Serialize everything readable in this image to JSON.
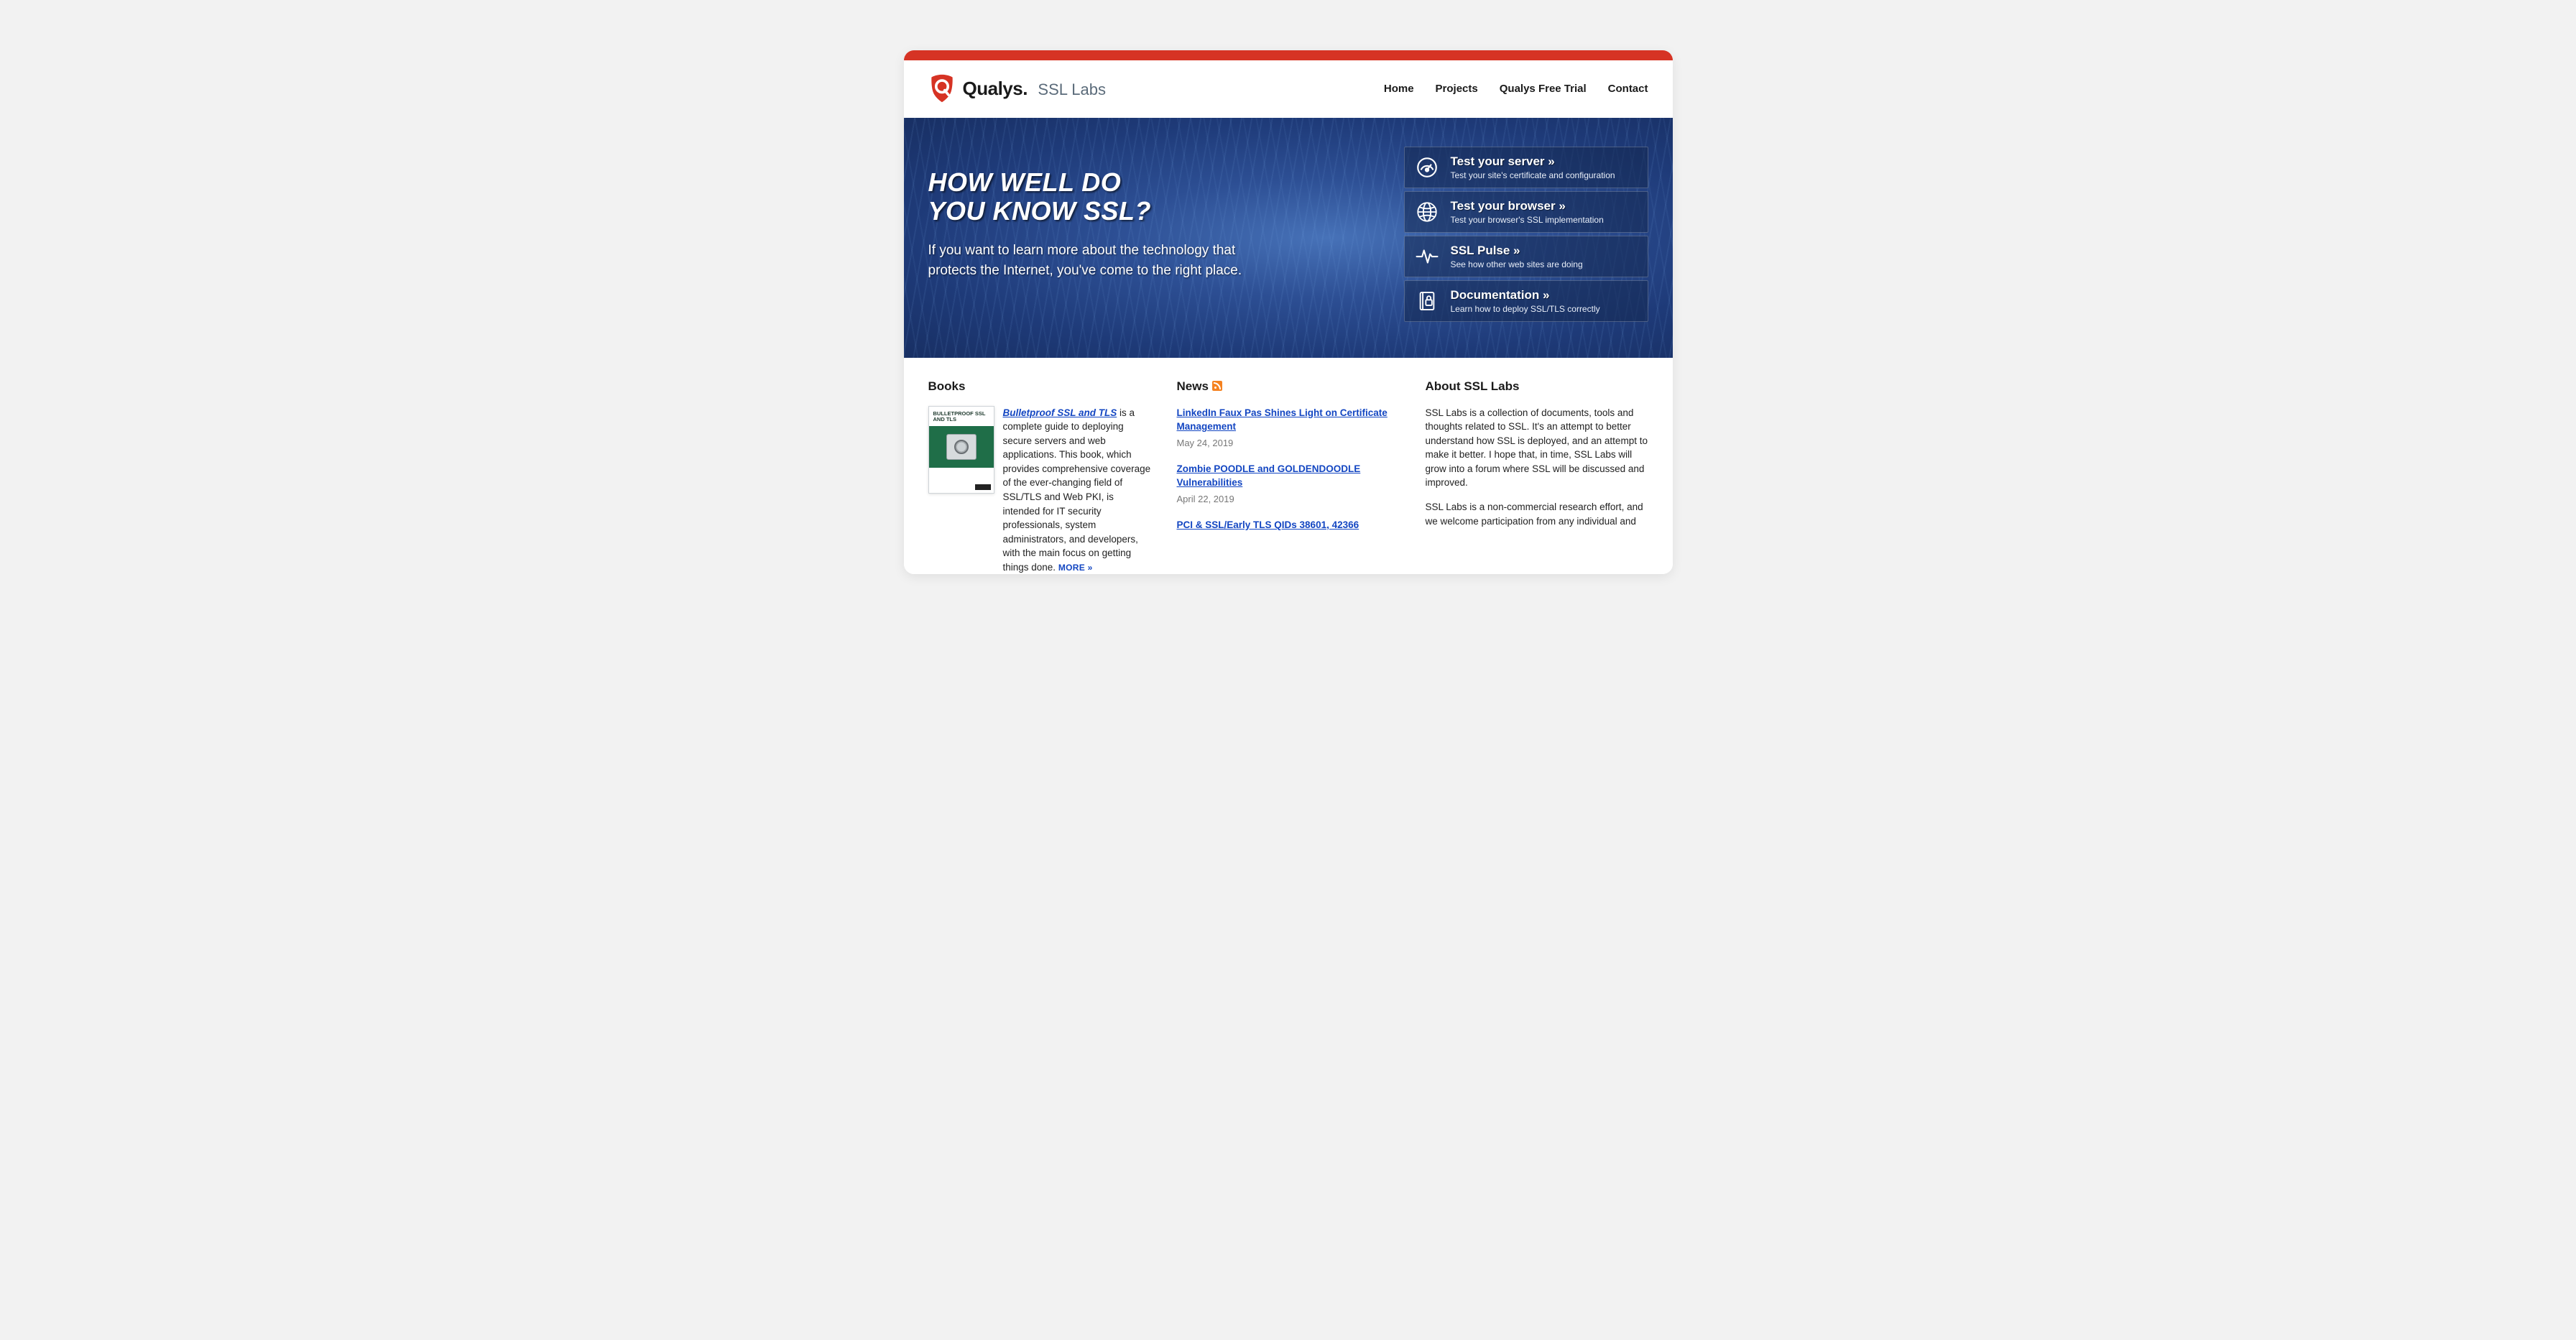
{
  "brand": {
    "name": "Qualys",
    "sub": "SSL Labs"
  },
  "nav": {
    "home": "Home",
    "projects": "Projects",
    "trial": "Qualys Free Trial",
    "contact": "Contact"
  },
  "hero": {
    "title_l1": "HOW WELL DO",
    "title_l2": "YOU KNOW SSL?",
    "desc": "If you want to learn more about the technology that protects the Internet, you've come to the right place."
  },
  "panels": {
    "server": {
      "title": "Test your server »",
      "sub": "Test your site's certificate and configuration"
    },
    "browser": {
      "title": "Test your browser »",
      "sub": "Test your browser's SSL implementation"
    },
    "pulse": {
      "title": "SSL Pulse »",
      "sub": "See how other web sites are doing"
    },
    "docs": {
      "title": "Documentation »",
      "sub": "Learn how to deploy SSL/TLS correctly"
    }
  },
  "books": {
    "heading": "Books",
    "cover_title": "BULLETPROOF SSL AND TLS",
    "link_text": "Bulletproof SSL and TLS",
    "blurb_after": " is a complete guide to deploying secure servers and web applications. This book, which provides comprehensive coverage of the ever-changing field of SSL/TLS and Web PKI, is intended for IT security professionals, system administrators, and developers, with the main focus on getting things done. ",
    "more": "MORE »"
  },
  "news": {
    "heading": "News",
    "items": [
      {
        "title": "LinkedIn Faux Pas Shines Light on Certificate Management",
        "date": "May 24, 2019"
      },
      {
        "title": "Zombie POODLE and GOLDENDOODLE Vulnerabilities",
        "date": "April 22, 2019"
      },
      {
        "title": "PCI & SSL/Early TLS QIDs 38601, 42366",
        "date": ""
      }
    ]
  },
  "about": {
    "heading": "About SSL Labs",
    "p1": "SSL Labs is a collection of documents, tools and thoughts related to SSL. It's an attempt to better understand how SSL is deployed, and an attempt to make it better. I hope that, in time, SSL Labs will grow into a forum where SSL will be discussed and improved.",
    "p2": "SSL Labs is a non-commercial research effort, and we welcome participation from any individual and"
  }
}
